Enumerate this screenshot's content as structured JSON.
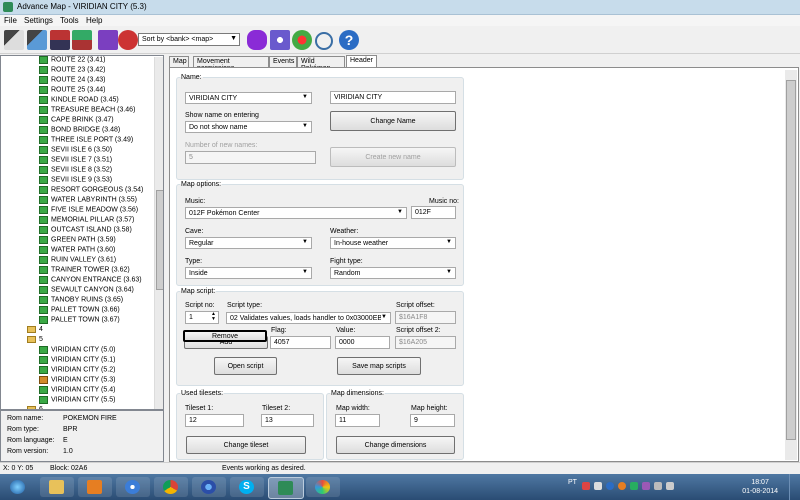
{
  "window": {
    "title": "Advance Map - VIRIDIAN CITY (5.3)"
  },
  "menu": [
    "File",
    "Settings",
    "Tools",
    "Help"
  ],
  "toolbar": {
    "sort_label": "Sort by <bank> <map>"
  },
  "tree": {
    "items": [
      "ROUTE 22 (3.41)",
      "ROUTE 23 (3.42)",
      "ROUTE 24 (3.43)",
      "ROUTE 25 (3.44)",
      "KINDLE ROAD (3.45)",
      "TREASURE BEACH (3.46)",
      "CAPE BRINK (3.47)",
      "BOND BRIDGE (3.48)",
      "THREE ISLE PORT (3.49)",
      "SEVII ISLE 6 (3.50)",
      "SEVII ISLE 7 (3.51)",
      "SEVII ISLE 8 (3.52)",
      "SEVII ISLE 9 (3.53)",
      "RESORT GORGEOUS (3.54)",
      "WATER LABYRINTH (3.55)",
      "FIVE ISLE MEADOW (3.56)",
      "MEMORIAL PILLAR (3.57)",
      "OUTCAST ISLAND (3.58)",
      "GREEN PATH (3.59)",
      "WATER PATH (3.60)",
      "RUIN VALLEY (3.61)",
      "TRAINER TOWER (3.62)",
      "CANYON ENTRANCE (3.63)",
      "SEVAULT CANYON (3.64)",
      "TANOBY RUINS (3.65)",
      "PALLET TOWN (3.66)",
      "PALLET TOWN (3.67)"
    ],
    "folder4": "4",
    "folder5": "5",
    "sub_items": [
      "VIRIDIAN CITY (5.0)",
      "VIRIDIAN CITY (5.1)",
      "VIRIDIAN CITY (5.2)",
      "VIRIDIAN CITY (5.3)",
      "VIRIDIAN CITY (5.4)",
      "VIRIDIAN CITY (5.5)"
    ],
    "folder6": "6"
  },
  "rom_info": {
    "rom_name_label": "Rom name:",
    "rom_name": "POKEMON FIRE",
    "rom_type_label": "Rom type:",
    "rom_type": "BPR",
    "rom_language_label": "Rom language:",
    "rom_language": "E",
    "rom_version_label": "Rom version:",
    "rom_version": "1.0"
  },
  "tabs": [
    "Map",
    "Movement permissions",
    "Events",
    "Wild Pokémon",
    "Header"
  ],
  "name_group": {
    "legend": "Name:",
    "name_select": "VIRIDIAN CITY",
    "name_text": "VIRIDIAN CITY",
    "show_label": "Show name on entering",
    "show_select": "Do not show name",
    "change_name_btn": "Change Name",
    "num_names_label": "Number of new names:",
    "num_names_value": "5",
    "create_name_btn": "Create new name"
  },
  "map_options": {
    "legend": "Map options:",
    "music_label": "Music:",
    "music_select": "012F Pokémon Center",
    "music_no_label": "Music no:",
    "music_no": "012F",
    "cave_label": "Cave:",
    "cave_select": "Regular",
    "weather_label": "Weather:",
    "weather_select": "In-house weather",
    "type_label": "Type:",
    "type_select": "Inside",
    "fight_label": "Fight type:",
    "fight_select": "Random"
  },
  "map_script": {
    "legend": "Map script:",
    "script_no_label": "Script no:",
    "script_no": "1",
    "script_type_label": "Script type:",
    "script_type": "02 Validates values, loads handler to 0x03000EB0",
    "script_offset_label": "Script offset:",
    "script_offset": "$16A1F8",
    "remove_btn": "Remove",
    "add_btn": "Add",
    "flag_label": "Flag:",
    "flag_value": "4057",
    "value_label": "Value:",
    "value_value": "0000",
    "offset2_label": "Script offset 2:",
    "offset2_value": "$16A205",
    "open_script_btn": "Open script",
    "save_scripts_btn": "Save map scripts"
  },
  "tilesets": {
    "legend": "Used tilesets:",
    "t1_label": "Tileset 1:",
    "t1": "12",
    "t2_label": "Tileset 2:",
    "t2": "13",
    "change_btn": "Change tileset"
  },
  "dimensions": {
    "legend": "Map dimensions:",
    "w_label": "Map width:",
    "w": "11",
    "h_label": "Map height:",
    "h": "9",
    "change_btn": "Change dimensions"
  },
  "status": {
    "coords": "X: 0  Y: 05",
    "block": "Block: 02A6",
    "message": "Events working as desired."
  },
  "taskbar": {
    "lang": "PT",
    "time": "18:07",
    "date": "01-08-2014"
  },
  "colors": {
    "accent": "#2a4c73",
    "tree_icon": "#3aa845",
    "selection_border": "#000000"
  }
}
